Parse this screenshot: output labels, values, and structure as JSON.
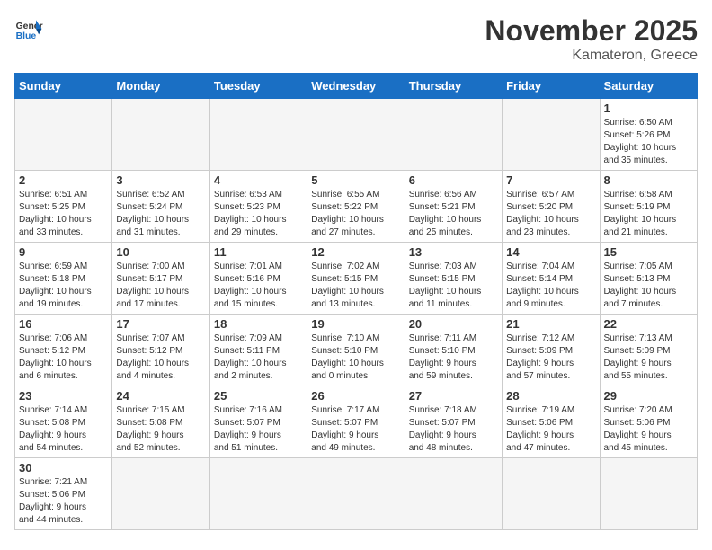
{
  "header": {
    "logo_text_general": "General",
    "logo_text_blue": "Blue",
    "title": "November 2025",
    "subtitle": "Kamateron, Greece"
  },
  "weekdays": [
    "Sunday",
    "Monday",
    "Tuesday",
    "Wednesday",
    "Thursday",
    "Friday",
    "Saturday"
  ],
  "weeks": [
    [
      {
        "day": "",
        "info": ""
      },
      {
        "day": "",
        "info": ""
      },
      {
        "day": "",
        "info": ""
      },
      {
        "day": "",
        "info": ""
      },
      {
        "day": "",
        "info": ""
      },
      {
        "day": "",
        "info": ""
      },
      {
        "day": "1",
        "info": "Sunrise: 6:50 AM\nSunset: 5:26 PM\nDaylight: 10 hours\nand 35 minutes."
      }
    ],
    [
      {
        "day": "2",
        "info": "Sunrise: 6:51 AM\nSunset: 5:25 PM\nDaylight: 10 hours\nand 33 minutes."
      },
      {
        "day": "3",
        "info": "Sunrise: 6:52 AM\nSunset: 5:24 PM\nDaylight: 10 hours\nand 31 minutes."
      },
      {
        "day": "4",
        "info": "Sunrise: 6:53 AM\nSunset: 5:23 PM\nDaylight: 10 hours\nand 29 minutes."
      },
      {
        "day": "5",
        "info": "Sunrise: 6:55 AM\nSunset: 5:22 PM\nDaylight: 10 hours\nand 27 minutes."
      },
      {
        "day": "6",
        "info": "Sunrise: 6:56 AM\nSunset: 5:21 PM\nDaylight: 10 hours\nand 25 minutes."
      },
      {
        "day": "7",
        "info": "Sunrise: 6:57 AM\nSunset: 5:20 PM\nDaylight: 10 hours\nand 23 minutes."
      },
      {
        "day": "8",
        "info": "Sunrise: 6:58 AM\nSunset: 5:19 PM\nDaylight: 10 hours\nand 21 minutes."
      }
    ],
    [
      {
        "day": "9",
        "info": "Sunrise: 6:59 AM\nSunset: 5:18 PM\nDaylight: 10 hours\nand 19 minutes."
      },
      {
        "day": "10",
        "info": "Sunrise: 7:00 AM\nSunset: 5:17 PM\nDaylight: 10 hours\nand 17 minutes."
      },
      {
        "day": "11",
        "info": "Sunrise: 7:01 AM\nSunset: 5:16 PM\nDaylight: 10 hours\nand 15 minutes."
      },
      {
        "day": "12",
        "info": "Sunrise: 7:02 AM\nSunset: 5:15 PM\nDaylight: 10 hours\nand 13 minutes."
      },
      {
        "day": "13",
        "info": "Sunrise: 7:03 AM\nSunset: 5:15 PM\nDaylight: 10 hours\nand 11 minutes."
      },
      {
        "day": "14",
        "info": "Sunrise: 7:04 AM\nSunset: 5:14 PM\nDaylight: 10 hours\nand 9 minutes."
      },
      {
        "day": "15",
        "info": "Sunrise: 7:05 AM\nSunset: 5:13 PM\nDaylight: 10 hours\nand 7 minutes."
      }
    ],
    [
      {
        "day": "16",
        "info": "Sunrise: 7:06 AM\nSunset: 5:12 PM\nDaylight: 10 hours\nand 6 minutes."
      },
      {
        "day": "17",
        "info": "Sunrise: 7:07 AM\nSunset: 5:12 PM\nDaylight: 10 hours\nand 4 minutes."
      },
      {
        "day": "18",
        "info": "Sunrise: 7:09 AM\nSunset: 5:11 PM\nDaylight: 10 hours\nand 2 minutes."
      },
      {
        "day": "19",
        "info": "Sunrise: 7:10 AM\nSunset: 5:10 PM\nDaylight: 10 hours\nand 0 minutes."
      },
      {
        "day": "20",
        "info": "Sunrise: 7:11 AM\nSunset: 5:10 PM\nDaylight: 9 hours\nand 59 minutes."
      },
      {
        "day": "21",
        "info": "Sunrise: 7:12 AM\nSunset: 5:09 PM\nDaylight: 9 hours\nand 57 minutes."
      },
      {
        "day": "22",
        "info": "Sunrise: 7:13 AM\nSunset: 5:09 PM\nDaylight: 9 hours\nand 55 minutes."
      }
    ],
    [
      {
        "day": "23",
        "info": "Sunrise: 7:14 AM\nSunset: 5:08 PM\nDaylight: 9 hours\nand 54 minutes."
      },
      {
        "day": "24",
        "info": "Sunrise: 7:15 AM\nSunset: 5:08 PM\nDaylight: 9 hours\nand 52 minutes."
      },
      {
        "day": "25",
        "info": "Sunrise: 7:16 AM\nSunset: 5:07 PM\nDaylight: 9 hours\nand 51 minutes."
      },
      {
        "day": "26",
        "info": "Sunrise: 7:17 AM\nSunset: 5:07 PM\nDaylight: 9 hours\nand 49 minutes."
      },
      {
        "day": "27",
        "info": "Sunrise: 7:18 AM\nSunset: 5:07 PM\nDaylight: 9 hours\nand 48 minutes."
      },
      {
        "day": "28",
        "info": "Sunrise: 7:19 AM\nSunset: 5:06 PM\nDaylight: 9 hours\nand 47 minutes."
      },
      {
        "day": "29",
        "info": "Sunrise: 7:20 AM\nSunset: 5:06 PM\nDaylight: 9 hours\nand 45 minutes."
      }
    ],
    [
      {
        "day": "30",
        "info": "Sunrise: 7:21 AM\nSunset: 5:06 PM\nDaylight: 9 hours\nand 44 minutes."
      },
      {
        "day": "",
        "info": ""
      },
      {
        "day": "",
        "info": ""
      },
      {
        "day": "",
        "info": ""
      },
      {
        "day": "",
        "info": ""
      },
      {
        "day": "",
        "info": ""
      },
      {
        "day": "",
        "info": ""
      }
    ]
  ]
}
